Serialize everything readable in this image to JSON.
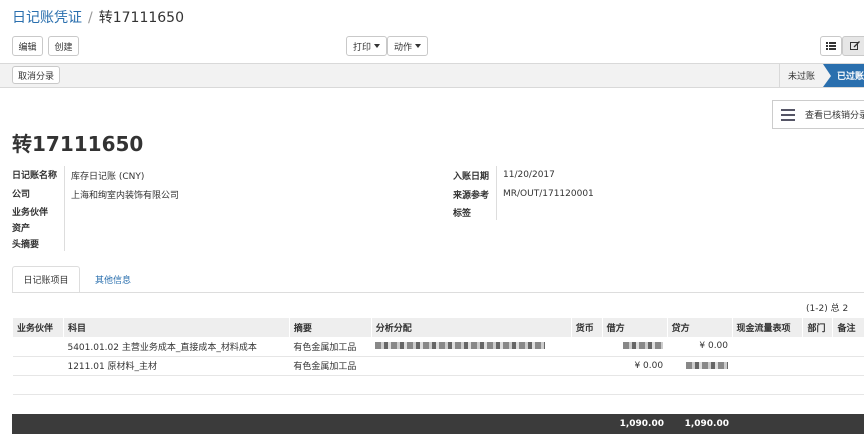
{
  "breadcrumb": {
    "parent": "日记账凭证",
    "separator": "/",
    "current": "转17111650"
  },
  "toolbar": {
    "edit": "编辑",
    "create": "创建",
    "print": "打印",
    "action": "动作"
  },
  "statusbar": {
    "cancel": "取消分录",
    "unposted": "未过账",
    "posted": "已过账"
  },
  "side": {
    "reconcile": "查看已核销分录"
  },
  "record": {
    "title": "转17111650",
    "journal_label": "日记账名称",
    "journal_value": "库存日记账 (CNY)",
    "company_label": "公司",
    "company_value": "上海和绚室内装饰有限公司",
    "partner_label": "业务伙伴",
    "asset_label": "资产",
    "head_summary_label": "头摘要",
    "date_label": "入账日期",
    "date_value": "11/20/2017",
    "ref_label": "来源参考",
    "ref_value": "MR/OUT/171120001",
    "tags_label": "标签"
  },
  "tabs": {
    "items": "日记账项目",
    "other": "其他信息"
  },
  "pager": "(1-2) 总 2",
  "table": {
    "headers": [
      "业务伙伴",
      "科目",
      "摘要",
      "分析分配",
      "货币",
      "借方",
      "贷方",
      "现金流量表项",
      "部门",
      "备注"
    ],
    "rows": [
      {
        "partner": "",
        "account": "5401.01.02 主营业务成本_直接成本_材料成本",
        "summary": "有色金属加工品",
        "debit": "",
        "credit": "¥ 0.00"
      },
      {
        "partner": "",
        "account": "1211.01 原材料_主材",
        "summary": "有色金属加工品",
        "debit": "¥ 0.00",
        "credit": ""
      }
    ],
    "total_debit": "1,090.00",
    "total_credit": "1,090.00"
  }
}
